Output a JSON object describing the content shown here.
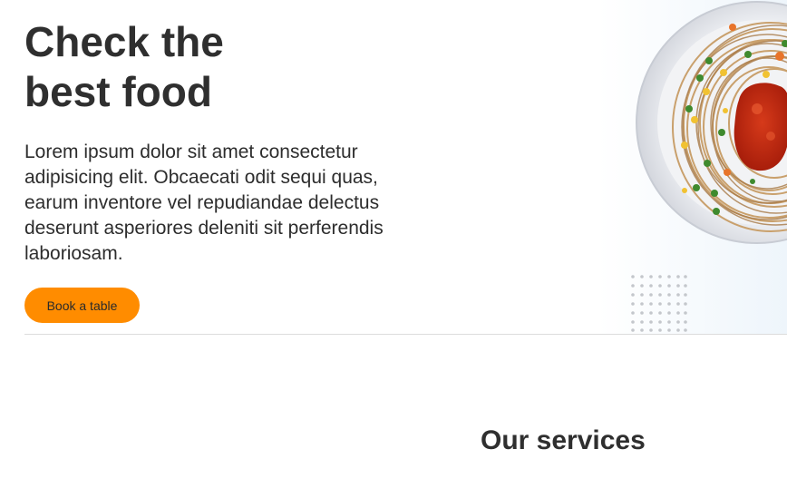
{
  "hero": {
    "title_lines": [
      "Check the",
      "best food"
    ],
    "description_lines": [
      "Lorem ipsum dolor sit amet consectetur",
      "adipisicing elit. Obcaecati odit sequi quas,",
      "earum inventore vel repudiandae delectus",
      "deserunt asperiores deleniti sit perferendis",
      "laboriosam."
    ],
    "cta_label": "Book a table",
    "image": "pasta-plate-image"
  },
  "services": {
    "title": "Our services"
  },
  "colors": {
    "accent": "#ff8c00",
    "text": "#2f2f2f",
    "divider": "#dcdcdc"
  }
}
